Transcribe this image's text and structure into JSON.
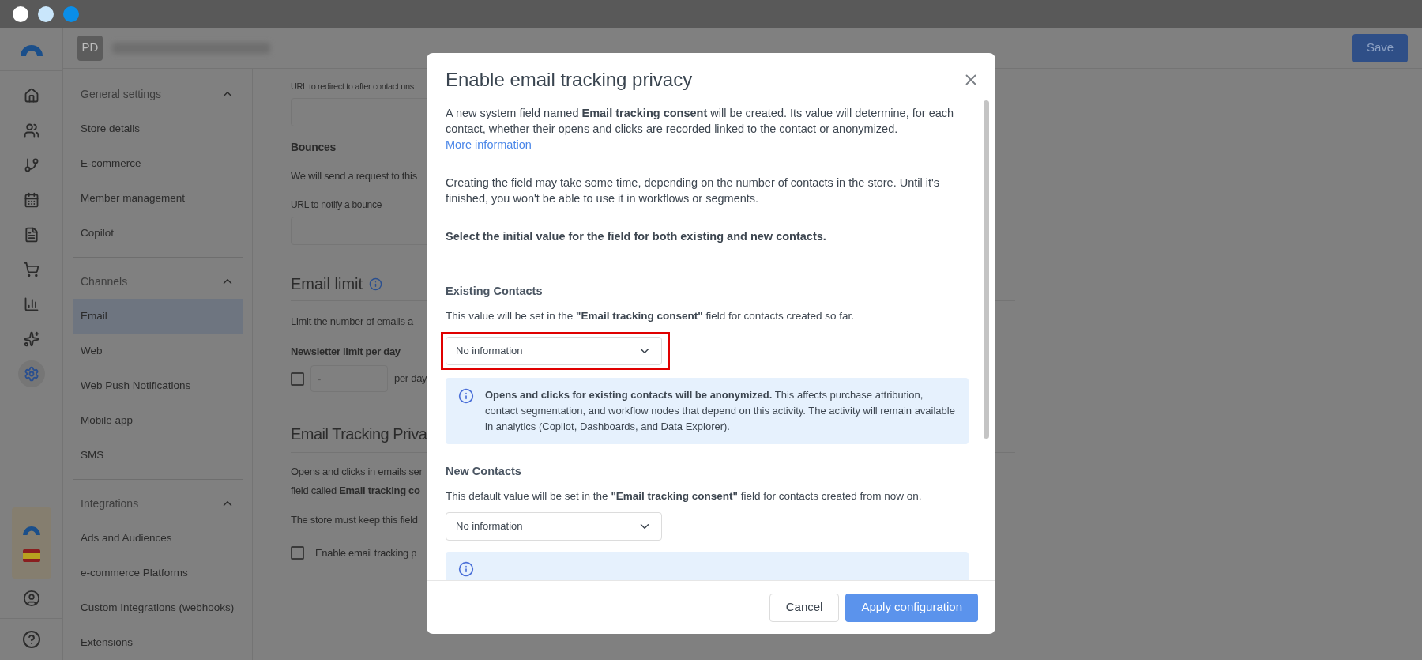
{
  "header": {
    "avatar": "PD",
    "save": "Save"
  },
  "nav": [
    {
      "title": "General settings",
      "expanded": true,
      "items": [
        {
          "label": "Store details",
          "selected": false
        },
        {
          "label": "E-commerce",
          "selected": false
        },
        {
          "label": "Member management",
          "selected": false
        },
        {
          "label": "Copilot",
          "selected": false
        }
      ]
    },
    {
      "title": "Channels",
      "expanded": true,
      "items": [
        {
          "label": "Email",
          "selected": true
        },
        {
          "label": "Web",
          "selected": false
        },
        {
          "label": "Web Push Notifications",
          "selected": false
        },
        {
          "label": "Mobile app",
          "selected": false
        },
        {
          "label": "SMS",
          "selected": false
        }
      ]
    },
    {
      "title": "Integrations",
      "expanded": true,
      "items": [
        {
          "label": "Ads and Audiences",
          "selected": false
        },
        {
          "label": "e-commerce Platforms",
          "selected": false
        },
        {
          "label": "Custom Integrations (webhooks)",
          "selected": false
        },
        {
          "label": "Extensions",
          "selected": false
        }
      ]
    }
  ],
  "rail": [
    {
      "kind": "home",
      "selected": false
    },
    {
      "kind": "contacts",
      "selected": false
    },
    {
      "kind": "workflows",
      "selected": false
    },
    {
      "kind": "calendar",
      "selected": false
    },
    {
      "kind": "documents",
      "selected": false
    },
    {
      "kind": "cart",
      "selected": false
    },
    {
      "kind": "analytics",
      "selected": false
    },
    {
      "kind": "ai",
      "selected": false
    },
    {
      "kind": "settings",
      "selected": true
    }
  ],
  "background": {
    "redirect_label": "URL to redirect to after contact uns",
    "bounces_title": "Bounces",
    "bounces_text": "We will send a request to this",
    "bounce_label": "URL to notify a bounce",
    "limit_title": "Email limit",
    "limit_text": "Limit the number of emails a",
    "newsletter_label": "Newsletter limit per day",
    "newsletter_checked": false,
    "newsletter_placeholder": "-",
    "per_day": "per day",
    "tracking_title": "Email Tracking Priva",
    "tracking_text_1": "Opens and clicks in emails ser",
    "tracking_text_2": "field called **Email tracking co**",
    "tracking_text_3": "The store must keep this field",
    "enable_label": "Enable email tracking p",
    "enable_checked": false
  },
  "modal": {
    "title": "Enable email tracking privacy",
    "intro": "A new system field named **Email tracking consent** will be created. Its value will determine, for each contact, whether their opens and clicks are recorded linked to the contact or anonymized.",
    "more_link": "More information",
    "note": "Creating the field may take some time, depending on the number of contacts in the store. Until it's finished, you won't be able to use it in workflows or segments.",
    "prompt": "Select the initial value for the field for both existing and new contacts.",
    "sections": [
      {
        "title": "Existing Contacts",
        "text": "This value will be set in the **\"Email tracking consent\"** field for contacts created so far.",
        "value": "No information",
        "highlighted": true,
        "info": "**Opens and clicks for existing contacts will be anonymized.** This affects purchase attribution, contact segmentation, and workflow nodes that depend on this activity. The activity will remain available in analytics (Copilot, Dashboards, and Data Explorer)."
      },
      {
        "title": "New Contacts",
        "text": "This default value will be set in the **\"Email tracking consent\"** field for contacts created from now on.",
        "value": "No information",
        "highlighted": false
      }
    ],
    "cancel": "Cancel",
    "apply": "Apply configuration"
  }
}
